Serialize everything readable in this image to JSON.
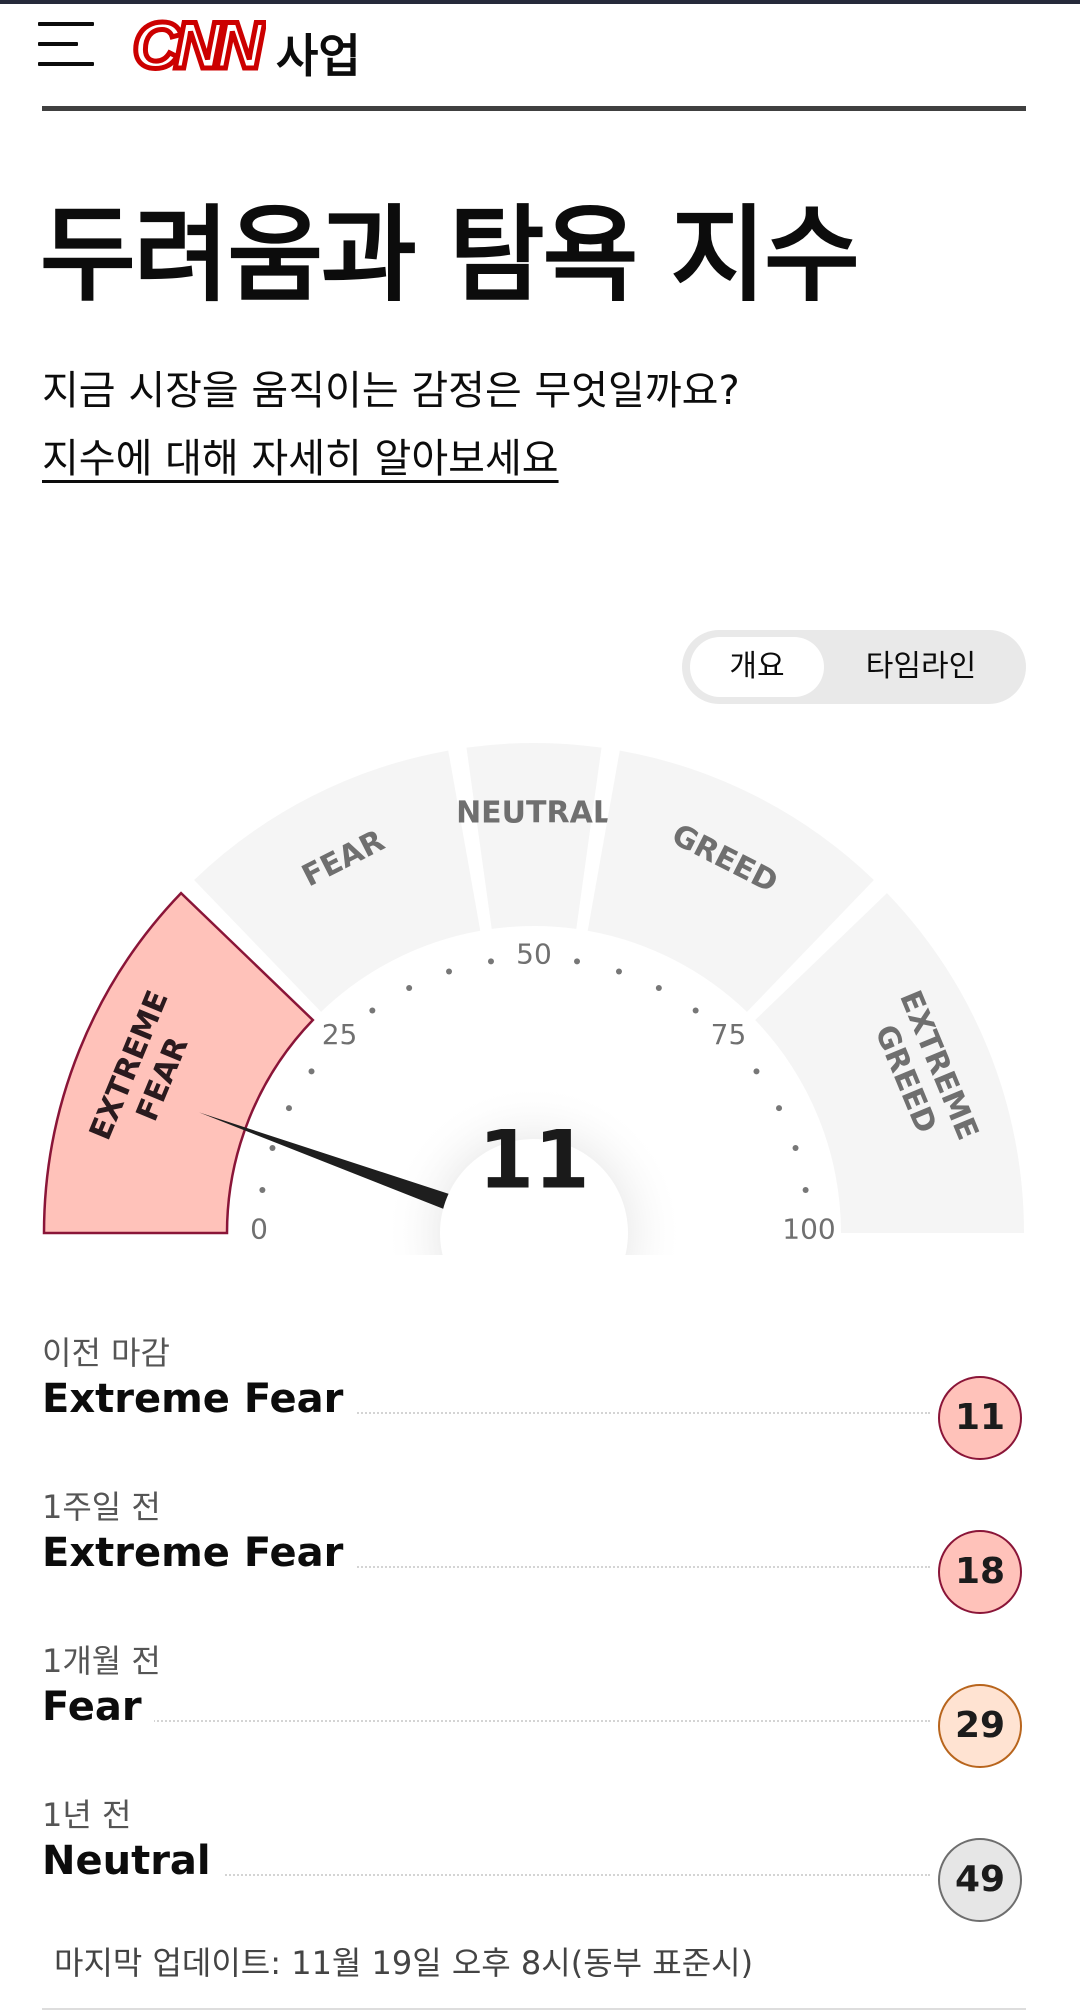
{
  "header": {
    "brand": "CNN",
    "section": "사업"
  },
  "page": {
    "title": "두려움과 탐욕 지수",
    "subtitle": "지금 시장을 움직이는 감정은 무엇일까요?",
    "learn_more_link": "지수에 대해 자세히 알아보세요"
  },
  "view_toggle": {
    "options": [
      "개요",
      "타임라인"
    ],
    "selected": "개요"
  },
  "gauge": {
    "value": 11,
    "min": 0,
    "max": 100,
    "current_zone": "EXTREME FEAR",
    "scale_labels": [
      "0",
      "25",
      "50",
      "75",
      "100"
    ],
    "zones": [
      {
        "lines": [
          "EXTREME",
          "FEAR"
        ],
        "from": 0,
        "to": 25,
        "active": true
      },
      {
        "lines": [
          "FEAR"
        ],
        "from": 25,
        "to": 45,
        "active": false
      },
      {
        "lines": [
          "NEUTRAL"
        ],
        "from": 45,
        "to": 55,
        "active": false
      },
      {
        "lines": [
          "GREED"
        ],
        "from": 55,
        "to": 75,
        "active": false
      },
      {
        "lines": [
          "EXTREME",
          "GREED"
        ],
        "from": 75,
        "to": 100,
        "active": false
      }
    ],
    "colors": {
      "active_fill": "#ffc2ba",
      "active_border": "#8a1538",
      "zone_fill": "#f5f5f5",
      "zone_text": "#6f6f6f",
      "needle": "#1e1e1e"
    }
  },
  "history": [
    {
      "period": "이전 마감",
      "rating": "Extreme Fear",
      "value": "11",
      "bubble_bg": "#ffc2ba",
      "bubble_border": "#8a1538"
    },
    {
      "period": "1주일 전",
      "rating": "Extreme Fear",
      "value": "18",
      "bubble_bg": "#ffc2ba",
      "bubble_border": "#8a1538"
    },
    {
      "period": "1개월 전",
      "rating": "Fear",
      "value": "29",
      "bubble_bg": "#ffe3d2",
      "bubble_border": "#b8651d"
    },
    {
      "period": "1년 전",
      "rating": "Neutral",
      "value": "49",
      "bubble_bg": "#e6e6e6",
      "bubble_border": "#6e6e6e"
    }
  ],
  "last_updated": "마지막 업데이트: 11월 19일 오후 8시(동부 표준시)",
  "icons": {
    "menu": "hamburger-menu-icon",
    "logo": "cnn-logo"
  }
}
